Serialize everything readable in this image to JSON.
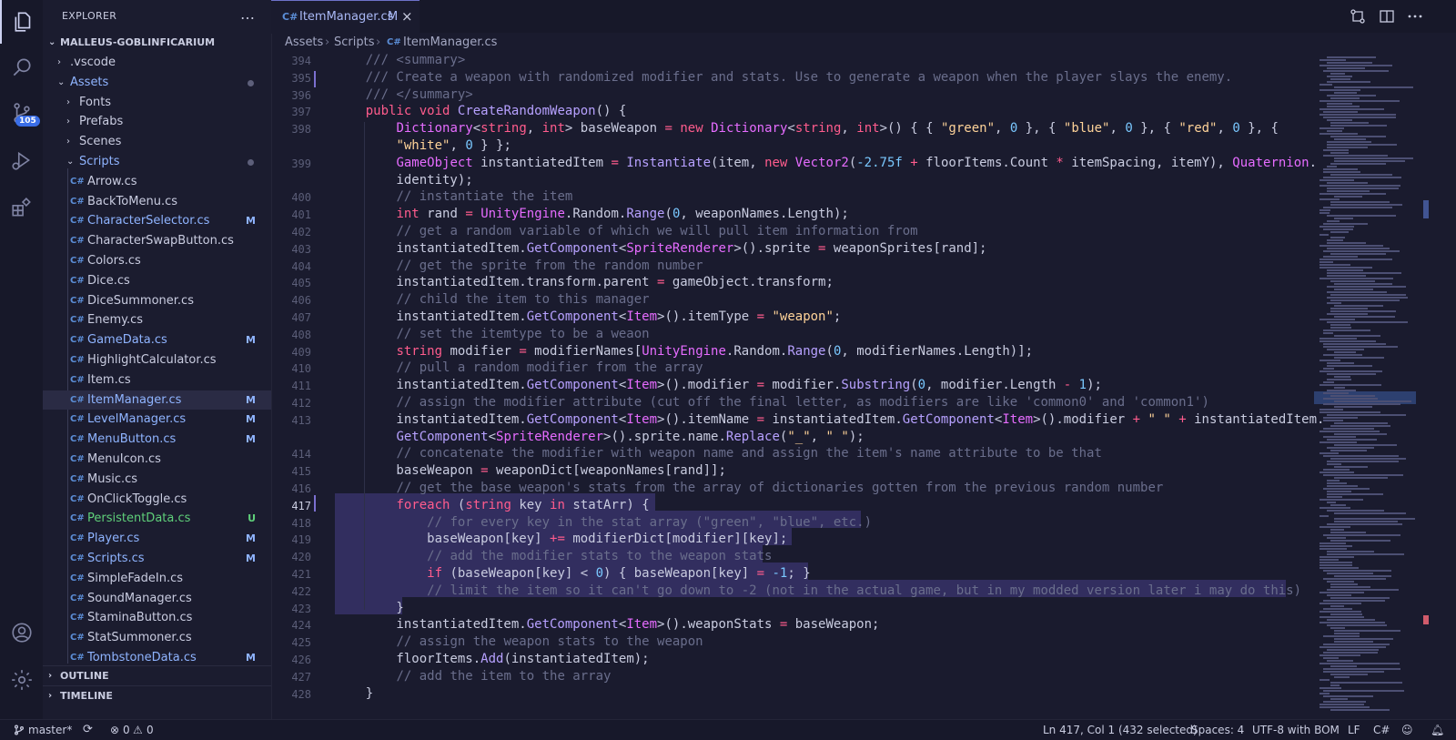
{
  "sidebar": {
    "title": "EXPLORER",
    "more_icon": "…",
    "project": "MALLEUS-GOBLINFICARIUM",
    "tree": [
      {
        "label": ".vscode",
        "kind": "folder",
        "open": false,
        "depth": 1
      },
      {
        "label": "Assets",
        "kind": "folder",
        "open": true,
        "depth": 1,
        "dot": true,
        "color": "#8fb4ff"
      },
      {
        "label": "Fonts",
        "kind": "folder",
        "open": false,
        "depth": 2
      },
      {
        "label": "Prefabs",
        "kind": "folder",
        "open": false,
        "depth": 2
      },
      {
        "label": "Scenes",
        "kind": "folder",
        "open": false,
        "depth": 2
      },
      {
        "label": "Scripts",
        "kind": "folder",
        "open": true,
        "depth": 2,
        "dot": true,
        "color": "#8fb4ff"
      },
      {
        "label": "Arrow.cs",
        "kind": "file",
        "depth": 3
      },
      {
        "label": "BackToMenu.cs",
        "kind": "file",
        "depth": 3
      },
      {
        "label": "CharacterSelector.cs",
        "kind": "file",
        "depth": 3,
        "badge": "M",
        "color": "#8fb4ff"
      },
      {
        "label": "CharacterSwapButton.cs",
        "kind": "file",
        "depth": 3
      },
      {
        "label": "Colors.cs",
        "kind": "file",
        "depth": 3
      },
      {
        "label": "Dice.cs",
        "kind": "file",
        "depth": 3
      },
      {
        "label": "DiceSummoner.cs",
        "kind": "file",
        "depth": 3
      },
      {
        "label": "Enemy.cs",
        "kind": "file",
        "depth": 3
      },
      {
        "label": "GameData.cs",
        "kind": "file",
        "depth": 3,
        "badge": "M",
        "color": "#8fb4ff"
      },
      {
        "label": "HighlightCalculator.cs",
        "kind": "file",
        "depth": 3
      },
      {
        "label": "Item.cs",
        "kind": "file",
        "depth": 3
      },
      {
        "label": "ItemManager.cs",
        "kind": "file",
        "depth": 3,
        "badge": "M",
        "color": "#8fb4ff",
        "selected": true
      },
      {
        "label": "LevelManager.cs",
        "kind": "file",
        "depth": 3,
        "badge": "M",
        "color": "#8fb4ff"
      },
      {
        "label": "MenuButton.cs",
        "kind": "file",
        "depth": 3,
        "badge": "M",
        "color": "#8fb4ff"
      },
      {
        "label": "MenuIcon.cs",
        "kind": "file",
        "depth": 3
      },
      {
        "label": "Music.cs",
        "kind": "file",
        "depth": 3
      },
      {
        "label": "OnClickToggle.cs",
        "kind": "file",
        "depth": 3
      },
      {
        "label": "PersistentData.cs",
        "kind": "file",
        "depth": 3,
        "badge": "U",
        "color": "#5fd07a"
      },
      {
        "label": "Player.cs",
        "kind": "file",
        "depth": 3,
        "badge": "M",
        "color": "#8fb4ff"
      },
      {
        "label": "Scripts.cs",
        "kind": "file",
        "depth": 3,
        "badge": "M",
        "color": "#8fb4ff"
      },
      {
        "label": "SimpleFadeIn.cs",
        "kind": "file",
        "depth": 3
      },
      {
        "label": "SoundManager.cs",
        "kind": "file",
        "depth": 3
      },
      {
        "label": "StaminaButton.cs",
        "kind": "file",
        "depth": 3
      },
      {
        "label": "StatSummoner.cs",
        "kind": "file",
        "depth": 3
      },
      {
        "label": "TombstoneData.cs",
        "kind": "file",
        "depth": 3,
        "badge": "M",
        "color": "#8fb4ff"
      }
    ],
    "outline": "OUTLINE",
    "timeline": "TIMELINE",
    "file_icon_glyph": "C#"
  },
  "activity": {
    "scm_badge": "105",
    "icons": [
      "explorer-icon",
      "search-icon",
      "source-control-icon",
      "run-debug-icon",
      "extensions-icon",
      "account-icon",
      "settings-gear-icon"
    ]
  },
  "editor": {
    "tab_icon": "C#",
    "tab_label": "ItemManager.cs",
    "tab_modified": "M",
    "tab_close": "×",
    "breadcrumbs": [
      "Assets",
      "Scripts",
      "ItemManager.cs"
    ],
    "breadcrumb_sep": "›",
    "current_line": "417",
    "lines": [
      {
        "n": "394",
        "t": "    /// <summary>"
      },
      {
        "n": "395",
        "t": "    /// Create a weapon with randomized modifier and stats. Use to generate a weapon when the player slays the enemy."
      },
      {
        "n": "396",
        "t": "    /// </summary>"
      },
      {
        "n": "397",
        "t": "    public void CreateRandomWeapon() {"
      },
      {
        "n": "398",
        "t": "        Dictionary<string, int> baseWeapon = new Dictionary<string, int>() { { \"green\", 0 }, { \"blue\", 0 }, { \"red\", 0 }, {"
      },
      {
        "n": "",
        "t": "        \"white\", 0 } };"
      },
      {
        "n": "399",
        "t": "        GameObject instantiatedItem = Instantiate(item, new Vector2(-2.75f + floorItems.Count * itemSpacing, itemY), Quaternion."
      },
      {
        "n": "",
        "t": "        identity);"
      },
      {
        "n": "400",
        "t": "        // instantiate the item"
      },
      {
        "n": "401",
        "t": "        int rand = UnityEngine.Random.Range(0, weaponNames.Length);"
      },
      {
        "n": "402",
        "t": "        // get a random variable of which we will pull item information from"
      },
      {
        "n": "403",
        "t": "        instantiatedItem.GetComponent<SpriteRenderer>().sprite = weaponSprites[rand];"
      },
      {
        "n": "404",
        "t": "        // get the sprite from the random number"
      },
      {
        "n": "405",
        "t": "        instantiatedItem.transform.parent = gameObject.transform;"
      },
      {
        "n": "406",
        "t": "        // child the item to this manager"
      },
      {
        "n": "407",
        "t": "        instantiatedItem.GetComponent<Item>().itemType = \"weapon\";"
      },
      {
        "n": "408",
        "t": "        // set the itemtype to be a weaon"
      },
      {
        "n": "409",
        "t": "        string modifier = modifierNames[UnityEngine.Random.Range(0, modifierNames.Length)];"
      },
      {
        "n": "410",
        "t": "        // pull a random modifier from the array"
      },
      {
        "n": "411",
        "t": "        instantiatedItem.GetComponent<Item>().modifier = modifier.Substring(0, modifier.Length - 1);"
      },
      {
        "n": "412",
        "t": "        // assign the modifier attribute (cut off the final letter, as modifiers are like 'common0' and 'common1')"
      },
      {
        "n": "413",
        "t": "        instantiatedItem.GetComponent<Item>().itemName = instantiatedItem.GetComponent<Item>().modifier + \" \" + instantiatedItem."
      },
      {
        "n": "",
        "t": "        GetComponent<SpriteRenderer>().sprite.name.Replace(\"_\", \" \");"
      },
      {
        "n": "414",
        "t": "        // concatenate the modifier with weapon name and assign the item's name attribute to be that"
      },
      {
        "n": "415",
        "t": "        baseWeapon = weaponDict[weaponNames[rand]];"
      },
      {
        "n": "416",
        "t": "        // get the base weapon's stats from the array of dictionaries gotten from the previous random number"
      },
      {
        "n": "417",
        "t": "        foreach (string key in statArr) {"
      },
      {
        "n": "418",
        "t": "            // for every key in the stat array (\"green\", \"blue\", etc.)"
      },
      {
        "n": "419",
        "t": "            baseWeapon[key] += modifierDict[modifier][key];"
      },
      {
        "n": "420",
        "t": "            // add the modifier stats to the weapon stats"
      },
      {
        "n": "421",
        "t": "            if (baseWeapon[key] < 0) { baseWeapon[key] = -1; }"
      },
      {
        "n": "422",
        "t": "            // limit the item so it can't go down to -2 (not in the actual game, but in my modded version later i may do this)"
      },
      {
        "n": "423",
        "t": "        }"
      },
      {
        "n": "424",
        "t": "        instantiatedItem.GetComponent<Item>().weaponStats = baseWeapon;"
      },
      {
        "n": "425",
        "t": "        // assign the weapon stats to the weapon"
      },
      {
        "n": "426",
        "t": "        floorItems.Add(instantiatedItem);"
      },
      {
        "n": "427",
        "t": "        // add the item to the array"
      },
      {
        "n": "428",
        "t": "    }"
      }
    ]
  },
  "status": {
    "branch": "master*",
    "errors": "0",
    "warnings": "0",
    "cursor": "Ln 417, Col 1 (432 selected)",
    "spaces": "Spaces: 4",
    "encoding": "UTF-8 with BOM",
    "eol": "LF",
    "language": "C#"
  },
  "colors": {
    "background": "#1a1b2e",
    "accent": "#6d71c9",
    "keyword": "#ff5c8d",
    "type": "#e66cff",
    "function": "#b7a1ff",
    "string": "#ffd399",
    "number": "#7ac8ff",
    "comment": "#6a6e8c",
    "modified": "#8fb4ff",
    "untracked": "#5fd07a"
  }
}
